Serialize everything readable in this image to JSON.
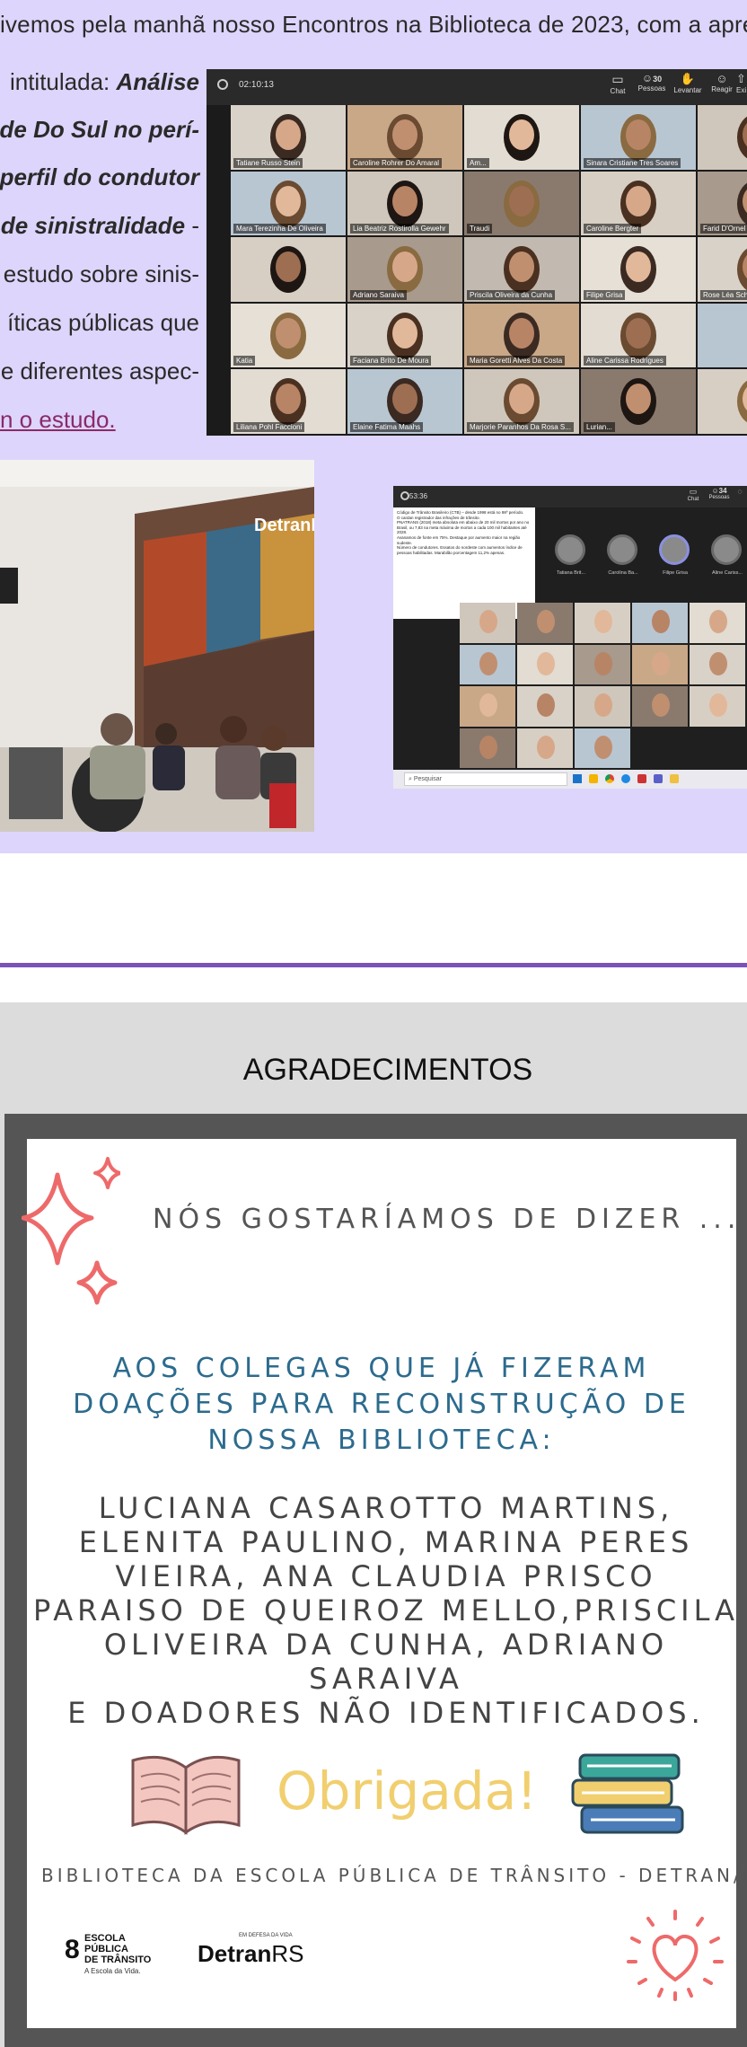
{
  "intro": {
    "line1": "ivemos pela manhã nosso Encontros na Biblioteca de 2023, com a apre",
    "para_lines": [
      {
        "pre": " intitulada: ",
        "bold": "Análise"
      },
      {
        "pre": "",
        "bold": "ande Do Sul no perí-"
      },
      {
        "pre": "",
        "bold": "o perfil do condutor"
      },
      {
        "pre": "",
        "bold": "de sinistralidade",
        "post": "  -"
      },
      {
        "pre": "estudo sobre sinis-"
      },
      {
        "pre": "íticas públicas que"
      },
      {
        "pre": "e diferentes aspec-"
      }
    ],
    "link": "n o estudo."
  },
  "meeting1": {
    "timer": "02:10:13",
    "toolbar": [
      {
        "label": "Chat",
        "icon": "chat-icon"
      },
      {
        "label": "Pessoas",
        "count": "30",
        "icon": "people-icon"
      },
      {
        "label": "Levantar",
        "icon": "raise-hand-icon"
      },
      {
        "label": "Reagir",
        "icon": "react-icon"
      },
      {
        "label": "Exi",
        "icon": "share-icon"
      }
    ],
    "participants": [
      [
        "Tatiane Russo Stein",
        "Caroline Rohrer Do Amaral",
        "Am...",
        "Sinara Cristiane Tres Soares",
        ""
      ],
      [
        "Mara Terezinha De Oliveira",
        "Lia Beatriz Rostirolla Gewehr",
        "Traudi",
        "Caroline Bergter",
        "Farid D'Ornel"
      ],
      [
        "",
        "Adriano Saraiva",
        "Priscila Oliveira da Cunha",
        "Filipe Grisa",
        "Rose Léa Sch"
      ],
      [
        "Katia",
        "Faciana Brito De Moura",
        "Maria Goretti Alves Da Costa",
        "Aline Carissa Rodrigues",
        ""
      ],
      [
        "Liliana Pohl Faccioni",
        "Elaine Fatima Maahs",
        "Marjorie Paranhos Da Rosa S...",
        "Lurian...",
        ""
      ]
    ]
  },
  "office_photo": {
    "sign": "DetranRS"
  },
  "meeting2": {
    "timer": "53:36",
    "toolbar": [
      {
        "label": "Chat",
        "icon": "chat-icon"
      },
      {
        "label": "Pessoas",
        "count": "34",
        "icon": "people-icon"
      },
      {
        "label": "",
        "icon": "more-icon"
      }
    ],
    "slide_text": [
      "Código de Trânsito Brasileiro (CTB) – desde 1998 está no 98º período.",
      "O cardan registrador das infrações de trânsito.",
      "PNATRANS (2018) meta absoluta em abaixo de 20 mil mortos por ano no Brasil, ou 7,83 na meta máxima de mortos a cada 100 mil habitantes até 2028.",
      "Avanamos de fonte em 75%. Destaque por aumento maior na região sudeste.",
      "Número de condutores. Essatos do nordeste com aumentos índice de pessoas habilitadas. Marabilão porcentagem 11,2% apenas."
    ],
    "avatars": [
      "Tatiana Brit...",
      "Carolina Ba...",
      "Filipe Grisa",
      "Aline Cariss..."
    ],
    "taskbar_search": "Pesquisar"
  },
  "agradecimentos": {
    "title": "AGRADECIMENTOS",
    "intro": "NÓS GOSTARÍAMOS DE DIZER ...",
    "blue_lines": [
      "AOS COLEGAS QUE JÁ  FIZERAM",
      "DOAÇÕES PARA RECONSTRUÇÃO DE",
      "NOSSA BIBLIOTECA:"
    ],
    "names_lines": [
      "LUCIANA CASAROTTO MARTINS,",
      "ELENITA PAULINO, MARINA PERES",
      "VIEIRA, ANA CLAUDIA PRISCO",
      "PARAISO DE QUEIROZ MELLO,PRISCILA",
      "OLIVEIRA DA CUNHA, ADRIANO",
      "SARAIVA",
      " E DOADORES NÃO IDENTIFICADOS."
    ],
    "thanks": "Obrigada!",
    "footer": "BIBLIOTECA DA ESCOLA  PÚBLICA DE TRÂNSITO - DETRAN/RS",
    "logo_escola": [
      "ESCOLA",
      "PÚBLICA",
      "DE TRÂNSITO"
    ],
    "logo_escola_tag": "A Escola da Vida.",
    "logo_detran_tag": "EM DEFESA DA VIDA",
    "logo_detran": "Detran",
    "logo_detran_suffix": "RS"
  },
  "colors": {
    "lavender": "#ddd5fb",
    "purple_line": "#7b52b8",
    "blue_text": "#2c6b8e",
    "coral": "#ee6a6a",
    "yellow": "#f1cf6f"
  }
}
